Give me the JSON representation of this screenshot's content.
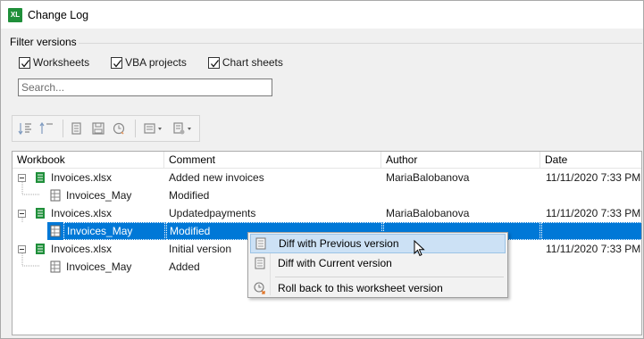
{
  "window": {
    "app_icon": "XL",
    "title": "Change Log"
  },
  "filter": {
    "legend": "Filter versions",
    "checkboxes": [
      {
        "label": "Worksheets",
        "checked": true
      },
      {
        "label": "VBA projects",
        "checked": true
      },
      {
        "label": "Chart sheets",
        "checked": true
      }
    ],
    "search_placeholder": "Search...",
    "search_value": ""
  },
  "toolbar": {
    "buttons": [
      "expand-all-icon",
      "collapse-all-icon",
      "view-icon",
      "save-icon",
      "rollback-icon",
      "diff-dropdown-icon",
      "compare-dropdown-icon"
    ]
  },
  "grid": {
    "columns": [
      "Workbook",
      "Comment",
      "Author",
      "Date"
    ],
    "rows": [
      {
        "level": 0,
        "name": "Invoices.xlsx",
        "comment": "Added new invoices",
        "author": "MariaBalobanova",
        "date": "11/11/2020 7:33 PM",
        "type": "workbook"
      },
      {
        "level": 1,
        "name": "Invoices_May",
        "comment": "Modified",
        "author": "",
        "date": "",
        "type": "sheet"
      },
      {
        "level": 0,
        "name": "Invoices.xlsx",
        "comment": "Updatedpayments",
        "author": "MariaBalobanova",
        "date": "11/11/2020 7:33 PM",
        "type": "workbook"
      },
      {
        "level": 1,
        "name": "Invoices_May",
        "comment": "Modified",
        "author": "",
        "date": "",
        "type": "sheet",
        "selected": true
      },
      {
        "level": 0,
        "name": "Invoices.xlsx",
        "comment": "Initial version",
        "author": "",
        "date": "11/11/2020 7:33 PM",
        "type": "workbook"
      },
      {
        "level": 1,
        "name": "Invoices_May",
        "comment": "Added",
        "author": "",
        "date": "",
        "type": "sheet"
      }
    ]
  },
  "context_menu": {
    "items": [
      {
        "label": "Diff with Previous version",
        "icon": "diff-previous-icon",
        "highlighted": true
      },
      {
        "label": "Diff with Current version",
        "icon": "diff-current-icon"
      },
      {
        "label": "Roll back to this worksheet version",
        "icon": "rollback-icon"
      }
    ]
  },
  "colors": {
    "selection": "#0078d7",
    "menu_highlight": "#cce1f5",
    "excel_green": "#1f8f3a"
  }
}
